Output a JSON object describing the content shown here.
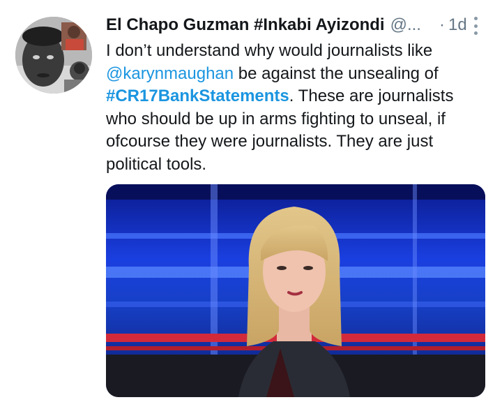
{
  "tweet": {
    "author_name": "El Chapo Guzman #Inkabi Ayizondi",
    "author_handle": "@...",
    "separator": "·",
    "time": "1d",
    "text": {
      "part1": "I don’t understand why would journalists like ",
      "mention": "@karynmaughan",
      "part2": " be against the unsealing of ",
      "hashtag": "#CR17BankStatements",
      "part3": ". These are journalists who should be up in arms fighting to unseal, if ofcourse they were journalists. They are just political tools."
    },
    "more_icon": "vertical-ellipsis-icon",
    "avatar_icon": "profile-photo",
    "media_icon": "news-presenter-photo"
  },
  "colors": {
    "link": "#1b95e0",
    "meta": "#657786",
    "text": "#14171a"
  }
}
